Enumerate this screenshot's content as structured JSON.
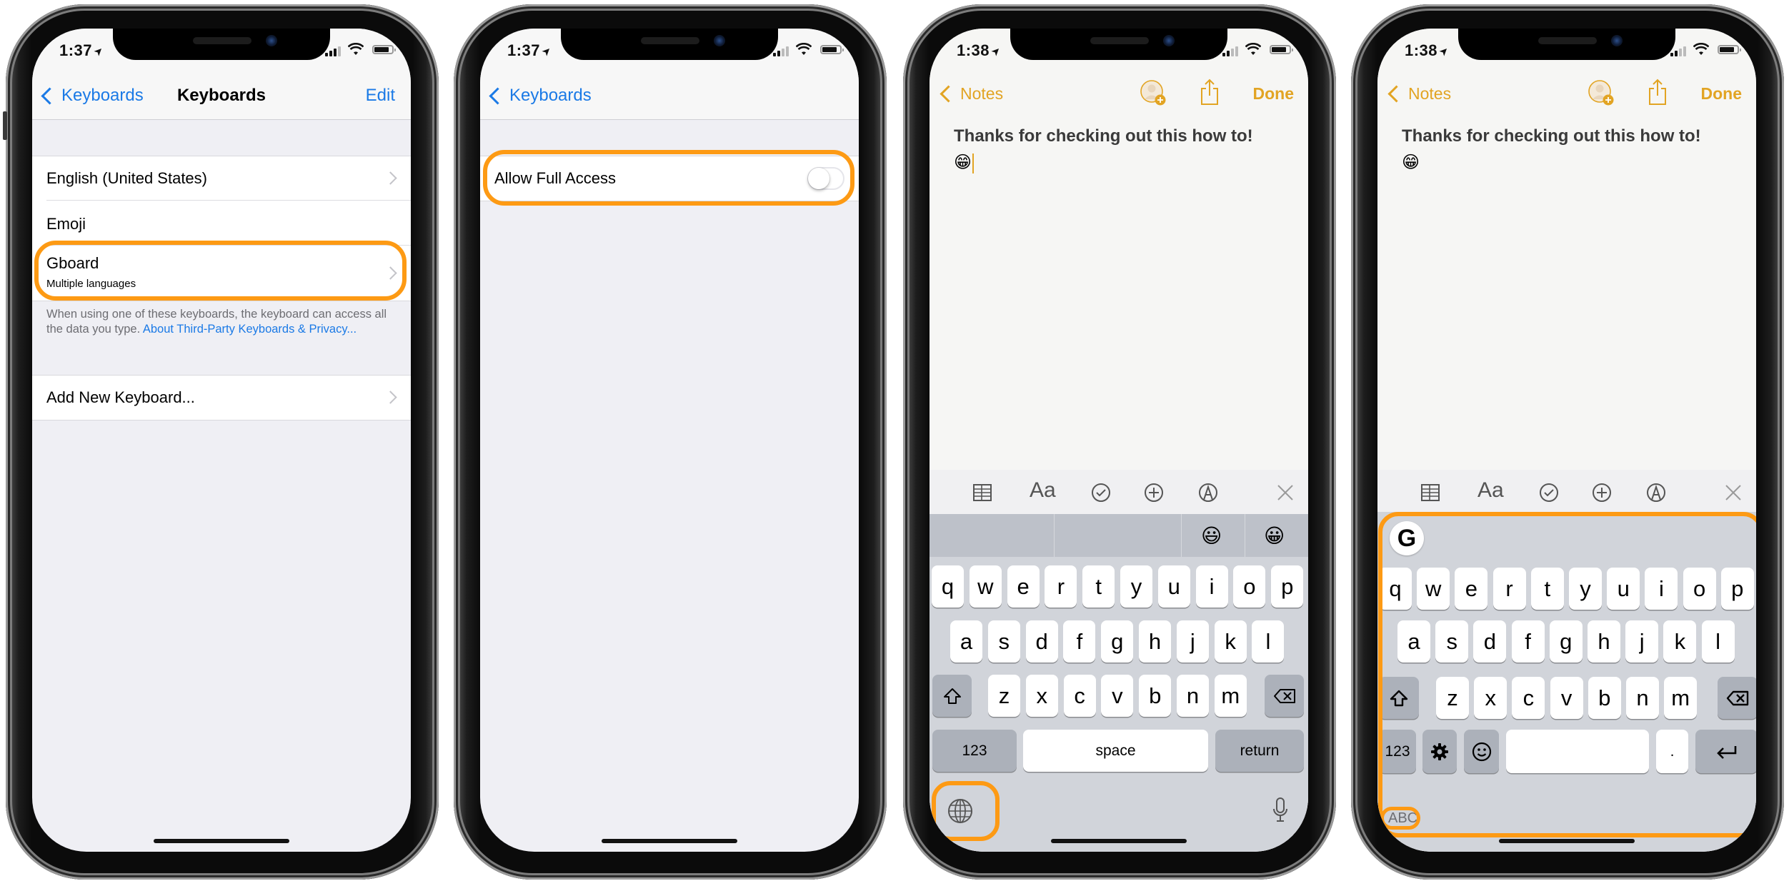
{
  "accent": {
    "highlight": "#FD9A14",
    "ios_blue": "#1B7AE6",
    "notes_gold": "#E2A423"
  },
  "phones": [
    {
      "status": {
        "time": "1:37"
      },
      "nav": {
        "back_label": "Keyboards",
        "title": "Keyboards",
        "action_label": "Edit"
      },
      "keyboards": [
        {
          "label": "English (United States)",
          "has_chevron": true
        },
        {
          "label": "Emoji",
          "has_chevron": false
        },
        {
          "label": "Gboard",
          "subtitle": "Multiple languages",
          "has_chevron": true,
          "highlighted": true
        }
      ],
      "footer": {
        "text": "When using one of these keyboards, the keyboard can access all the data you type.",
        "link": "About Third-Party Keyboards & Privacy..."
      },
      "add_keyboard": "Add New Keyboard..."
    },
    {
      "status": {
        "time": "1:37"
      },
      "nav": {
        "back_label": "Keyboards"
      },
      "setting": {
        "label": "Allow Full Access",
        "toggle_on": false,
        "highlighted": true
      }
    },
    {
      "status": {
        "time": "1:38"
      },
      "nav": {
        "back_label": "Notes",
        "done_label": "Done",
        "icons": [
          "add-person-icon",
          "share-icon"
        ]
      },
      "note": {
        "text": "Thanks for checking out this how to!",
        "emoji": "😁"
      },
      "toolbar": [
        "table-icon",
        "text-format-icon",
        "checklist-icon",
        "add-icon",
        "markup-icon",
        "close-icon"
      ],
      "toolbar_text": {
        "format": "Aa"
      },
      "suggestions": [
        "",
        "",
        "😃",
        "😀"
      ],
      "keyboard": {
        "row1": [
          "q",
          "w",
          "e",
          "r",
          "t",
          "y",
          "u",
          "i",
          "o",
          "p"
        ],
        "row2": [
          "a",
          "s",
          "d",
          "f",
          "g",
          "h",
          "j",
          "k",
          "l"
        ],
        "row3": [
          "z",
          "x",
          "c",
          "v",
          "b",
          "n",
          "m"
        ],
        "numbers": "123",
        "space": "space",
        "return": "return",
        "globe_highlighted": true
      }
    },
    {
      "status": {
        "time": "1:38"
      },
      "nav": {
        "back_label": "Notes",
        "done_label": "Done"
      },
      "note": {
        "text": "Thanks for checking out this how to!",
        "emoji": "😁"
      },
      "toolbar_text": {
        "format": "Aa"
      },
      "gboard": {
        "logo": "G",
        "row1": [
          "q",
          "w",
          "e",
          "r",
          "t",
          "y",
          "u",
          "i",
          "o",
          "p"
        ],
        "row2": [
          "a",
          "s",
          "d",
          "f",
          "g",
          "h",
          "j",
          "k",
          "l"
        ],
        "row3": [
          "z",
          "x",
          "c",
          "v",
          "b",
          "n",
          "m"
        ],
        "numbers": "123",
        "period": ".",
        "switch_label": "ABC",
        "highlighted": true
      }
    }
  ]
}
